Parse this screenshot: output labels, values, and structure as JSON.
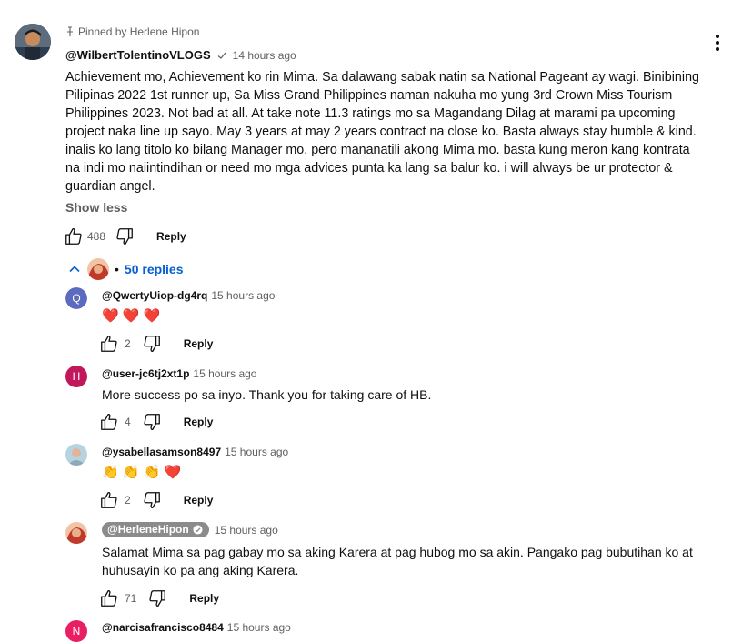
{
  "comment": {
    "pinned_label": "Pinned by Herlene Hipon",
    "author": "@WilbertTolentinoVLOGS",
    "time": "14 hours ago",
    "text": "Achievement mo, Achievement ko rin Mima. Sa dalawang sabak natin sa National Pageant ay wagi. Binibining Pilipinas 2022 1st runner up, Sa Miss Grand Philippines naman nakuha mo yung 3rd Crown Miss Tourism Philippines 2023. Not bad at all. At take note 11.3 ratings mo sa Magandang Dilag at marami pa upcoming project naka line up sayo. May 3 years at may 2 years contract na close ko. Basta always stay humble & kind. inalis ko lang titolo ko bilang Manager mo, pero mananatili akong Mima mo. basta kung meron kang kontrata na indi mo naiintindihan or need mo mga advices punta ka lang sa balur ko.  i will always be ur protector & guardian angel.",
    "show_less": "Show less",
    "likes": "488",
    "reply_label": "Reply",
    "replies_toggle": "50 replies",
    "replies_bullet": "•"
  },
  "replies": [
    {
      "initial": "Q",
      "avatar_color": "#5c6bc0",
      "author": "@QwertyUiop-dg4rq",
      "time": "15 hours ago",
      "text": "❤️ ❤️ ❤️",
      "likes": "2",
      "reply_label": "Reply"
    },
    {
      "initial": "H",
      "avatar_color": "#c2185b",
      "author": "@user-jc6tj2xt1p",
      "time": "15 hours ago",
      "text": "More success po sa inyo. Thank you for taking care of HB.",
      "likes": "4",
      "reply_label": "Reply"
    },
    {
      "author": "@ysabellasamson8497",
      "time": "15 hours ago",
      "text": "👏 👏 👏 ❤️",
      "likes": "2",
      "reply_label": "Reply"
    },
    {
      "author": "@HerleneHipon",
      "time": "15 hours ago",
      "text": "Salamat Mima sa pag gabay mo sa aking Karera at pag hubog mo sa akin. Pangako pag bubutihan ko at huhusayin ko pa ang aking Karera.",
      "likes": "71",
      "reply_label": "Reply"
    },
    {
      "initial": "N",
      "avatar_color": "#e91e63",
      "author": "@narcisafrancisco8484",
      "time": "15 hours ago"
    }
  ]
}
